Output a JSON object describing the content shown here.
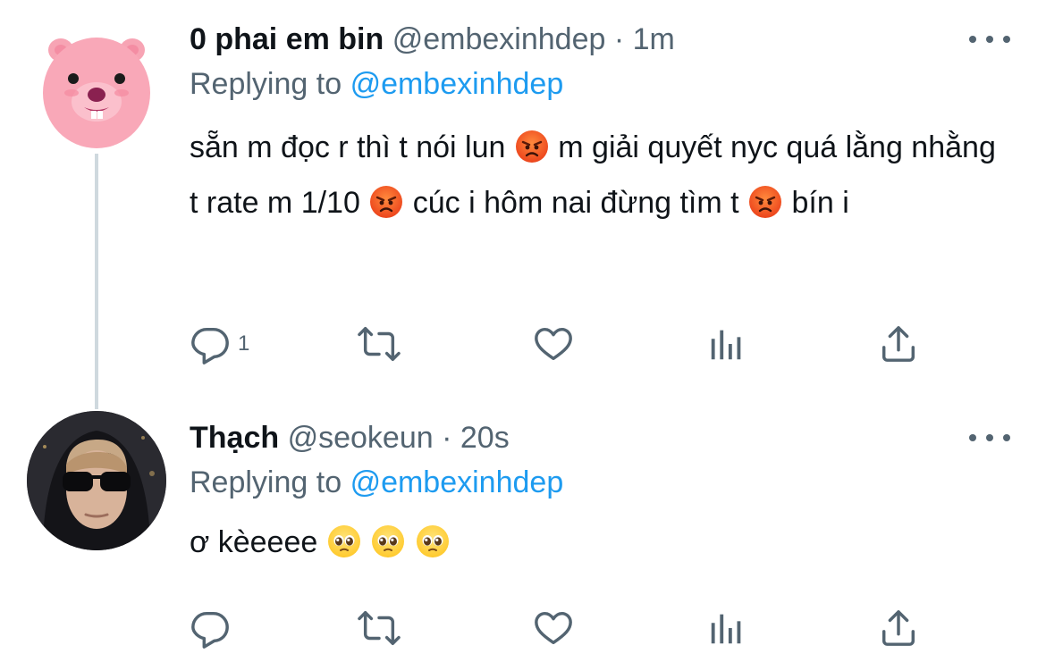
{
  "colors": {
    "text_primary": "#0f1419",
    "text_secondary": "#536471",
    "accent": "#1d9bf0",
    "thread_line": "#cfd9de"
  },
  "tweets": [
    {
      "display_name": "0 phai em bin",
      "handle": "@embexinhdep",
      "separator": "·",
      "time": "1m",
      "replying_prefix": "Replying to",
      "replying_to": "@embexinhdep",
      "text_parts": [
        "sẵn m đọc r thì t nói lun ",
        " m giải quyết nyc quá lằng nhằng t rate m 1/10 ",
        " cúc i hôm nai đừng tìm t ",
        " bín i"
      ],
      "emojis": [
        "angry-face-emoji",
        "angry-face-emoji",
        "angry-face-emoji"
      ],
      "avatar_icon": "pink-beaver-avatar",
      "actions": {
        "reply_count": "1",
        "retweet_count": "",
        "like_count": ""
      }
    },
    {
      "display_name": "Thạch",
      "handle": "@seokeun",
      "separator": "·",
      "time": "20s",
      "replying_prefix": "Replying to",
      "replying_to": "@embexinhdep",
      "text_parts": [
        "ơ kèeeee "
      ],
      "emojis": [
        "pleading-face-emoji",
        "pleading-face-emoji",
        "pleading-face-emoji"
      ],
      "avatar_icon": "user-photo-avatar",
      "actions": {
        "reply_count": "",
        "retweet_count": "",
        "like_count": ""
      }
    }
  ]
}
